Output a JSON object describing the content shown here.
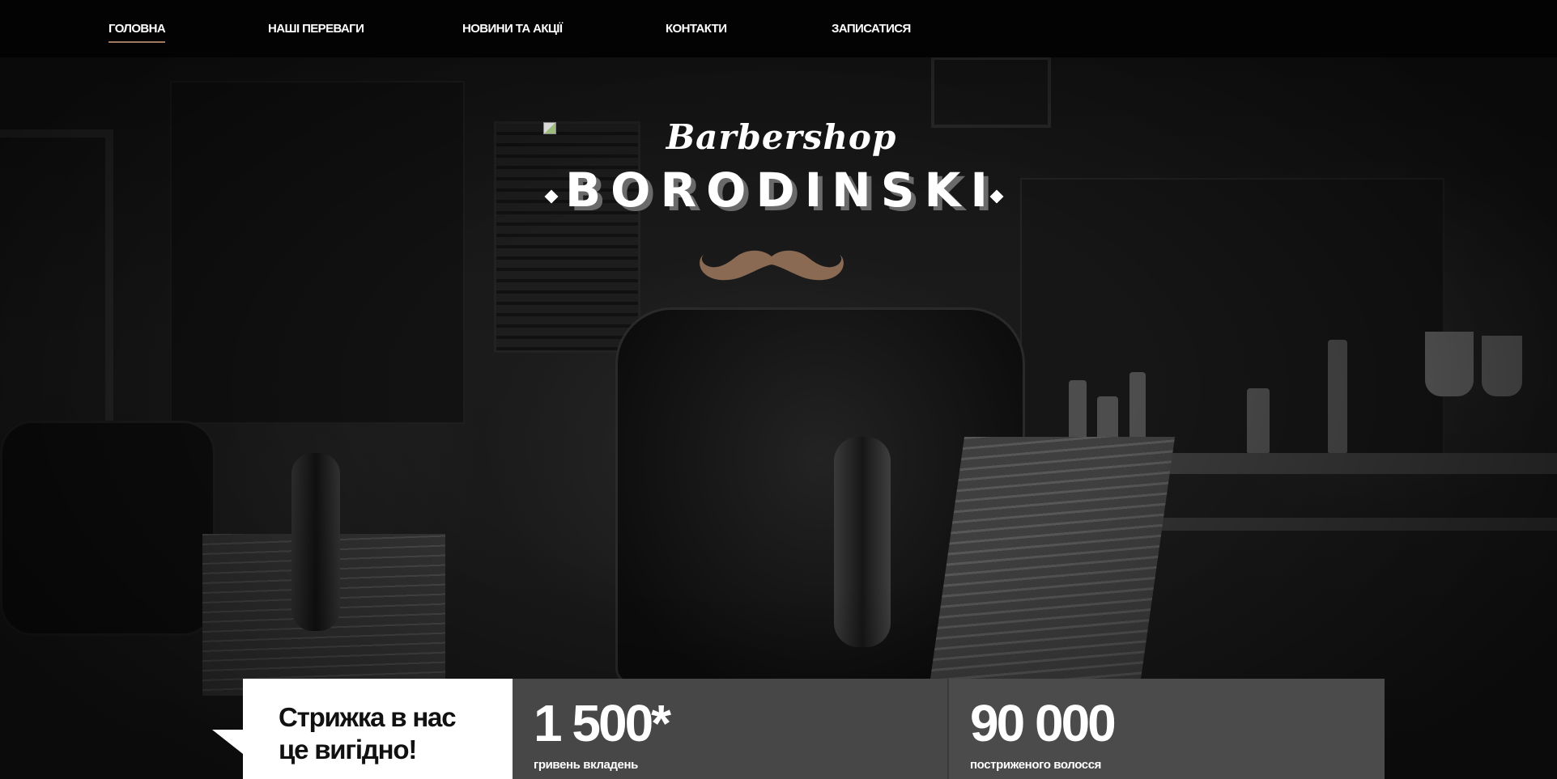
{
  "nav": {
    "items": [
      {
        "label": "ГОЛОВНА",
        "active": true
      },
      {
        "label": "НАШІ ПЕРЕВАГИ",
        "active": false
      },
      {
        "label": "НОВИНИ ТА АКЦІЇ",
        "active": false
      },
      {
        "label": "КОНТАКТИ",
        "active": false
      },
      {
        "label": "ЗАПИСАТИСЯ",
        "active": false
      }
    ]
  },
  "logo": {
    "script_text": "Barbershop",
    "main_text": "BORODINSKI",
    "icon": "mustache-icon"
  },
  "promo": {
    "line1": "Стрижка в нас",
    "line2": "це вигідно!"
  },
  "stats": [
    {
      "value": "1 500*",
      "label": "гривень вкладень"
    },
    {
      "value": "90 000",
      "label": "постриженого волосся"
    }
  ],
  "colors": {
    "nav_background": "#030303",
    "active_underline": "#a07a60",
    "mustache": "#8a6a52",
    "stat_background": "#4a4a4a",
    "promo_background": "#ffffff"
  }
}
